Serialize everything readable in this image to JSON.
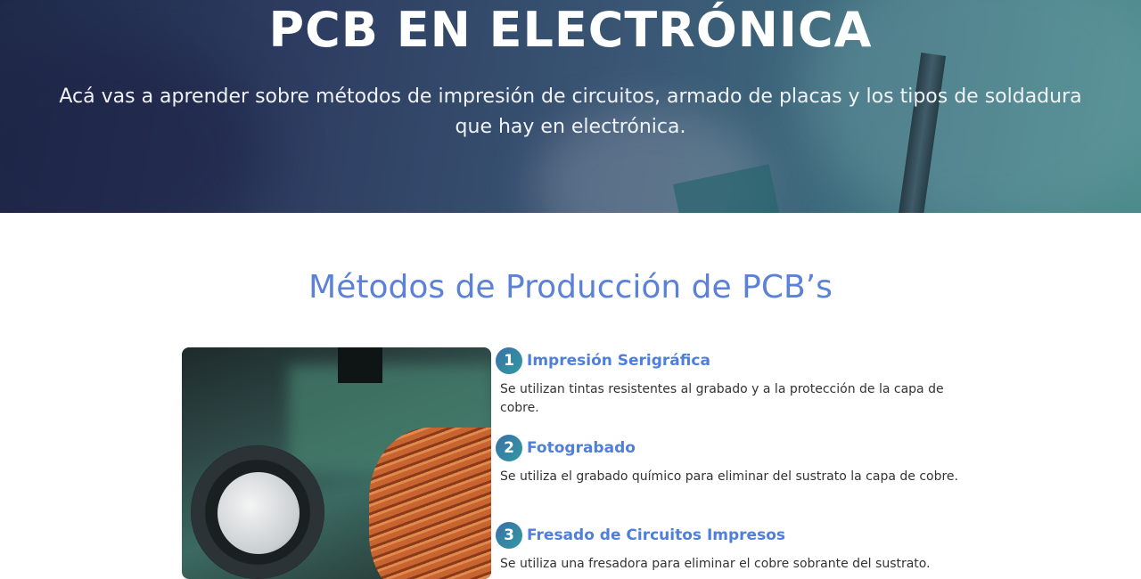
{
  "hero": {
    "title": "PCB EN ELECTRÓNICA",
    "subtitle": "Acá vas a aprender sobre métodos de impresión de circuitos, armado de placas y los tipos de soldadura que hay en electrónica."
  },
  "section": {
    "title": "Métodos de Producción de PCB’s"
  },
  "methods": [
    {
      "number": "1",
      "title": "Impresión Serigráfica",
      "description": "Se utilizan tintas resistentes al grabado y a la protección de la capa de cobre."
    },
    {
      "number": "2",
      "title": "Fotograbado",
      "description": "Se utiliza el grabado químico para eliminar del sustrato la capa de cobre."
    },
    {
      "number": "3",
      "title": "Fresado de Circuitos Impresos",
      "description": "Se utiliza una fresadora para eliminar el cobre sobrante del sustrato."
    }
  ],
  "colors": {
    "accent": "#5b82d6",
    "badge": "#2f9aa0"
  }
}
